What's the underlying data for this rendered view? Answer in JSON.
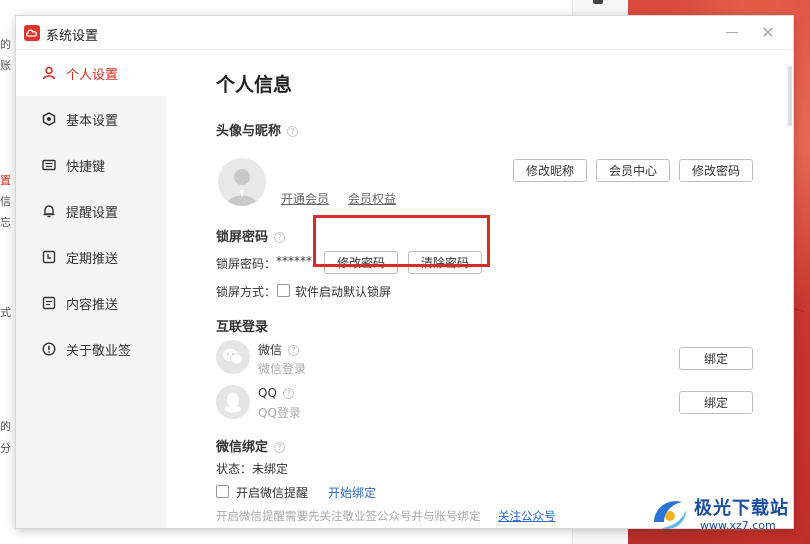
{
  "background": {
    "left_fragments": [
      "的",
      "账",
      "置",
      "信",
      "忘",
      "式",
      "的",
      "分"
    ]
  },
  "dialog": {
    "title": "系统设置",
    "sidebar": {
      "items": [
        {
          "label": "个人设置",
          "icon": "user-icon",
          "active": true
        },
        {
          "label": "基本设置",
          "icon": "settings-icon",
          "active": false
        },
        {
          "label": "快捷键",
          "icon": "keyboard-icon",
          "active": false
        },
        {
          "label": "提醒设置",
          "icon": "bell-icon",
          "active": false
        },
        {
          "label": "定期推送",
          "icon": "clock-icon",
          "active": false
        },
        {
          "label": "内容推送",
          "icon": "document-icon",
          "active": false
        },
        {
          "label": "关于敬业签",
          "icon": "info-icon",
          "active": false
        }
      ]
    },
    "main": {
      "page_title": "个人信息",
      "avatar_section": {
        "title": "头像与昵称",
        "links": [
          "开通会员",
          "会员权益"
        ],
        "buttons": [
          "修改昵称",
          "会员中心",
          "修改密码"
        ]
      },
      "lock_section": {
        "title": "锁屏密码",
        "password_label": "锁屏密码：",
        "password_value": "******",
        "change_button": "修改密码",
        "clear_button": "清除密码",
        "mode_label": "锁屏方式：",
        "mode_option": "软件启动默认锁屏"
      },
      "social_section": {
        "title": "互联登录",
        "accounts": [
          {
            "name": "微信",
            "status": "微信登录",
            "button": "绑定"
          },
          {
            "name": "QQ",
            "status": "QQ登录",
            "button": "绑定"
          }
        ]
      },
      "wechat_section": {
        "title": "微信绑定",
        "status": "状态：未绑定",
        "reminder_label": "开启微信提醒",
        "start_bind": "开始绑定",
        "hint": "开启微信提醒需要先关注敬业签公众号并与账号绑定",
        "follow_link": "关注公众号"
      }
    }
  },
  "watermark": {
    "text": "极光下载站",
    "url": "www.xz7.com"
  },
  "colors": {
    "accent": "#d92b22",
    "link": "#2a66c6",
    "highlight": "#d62d28"
  }
}
